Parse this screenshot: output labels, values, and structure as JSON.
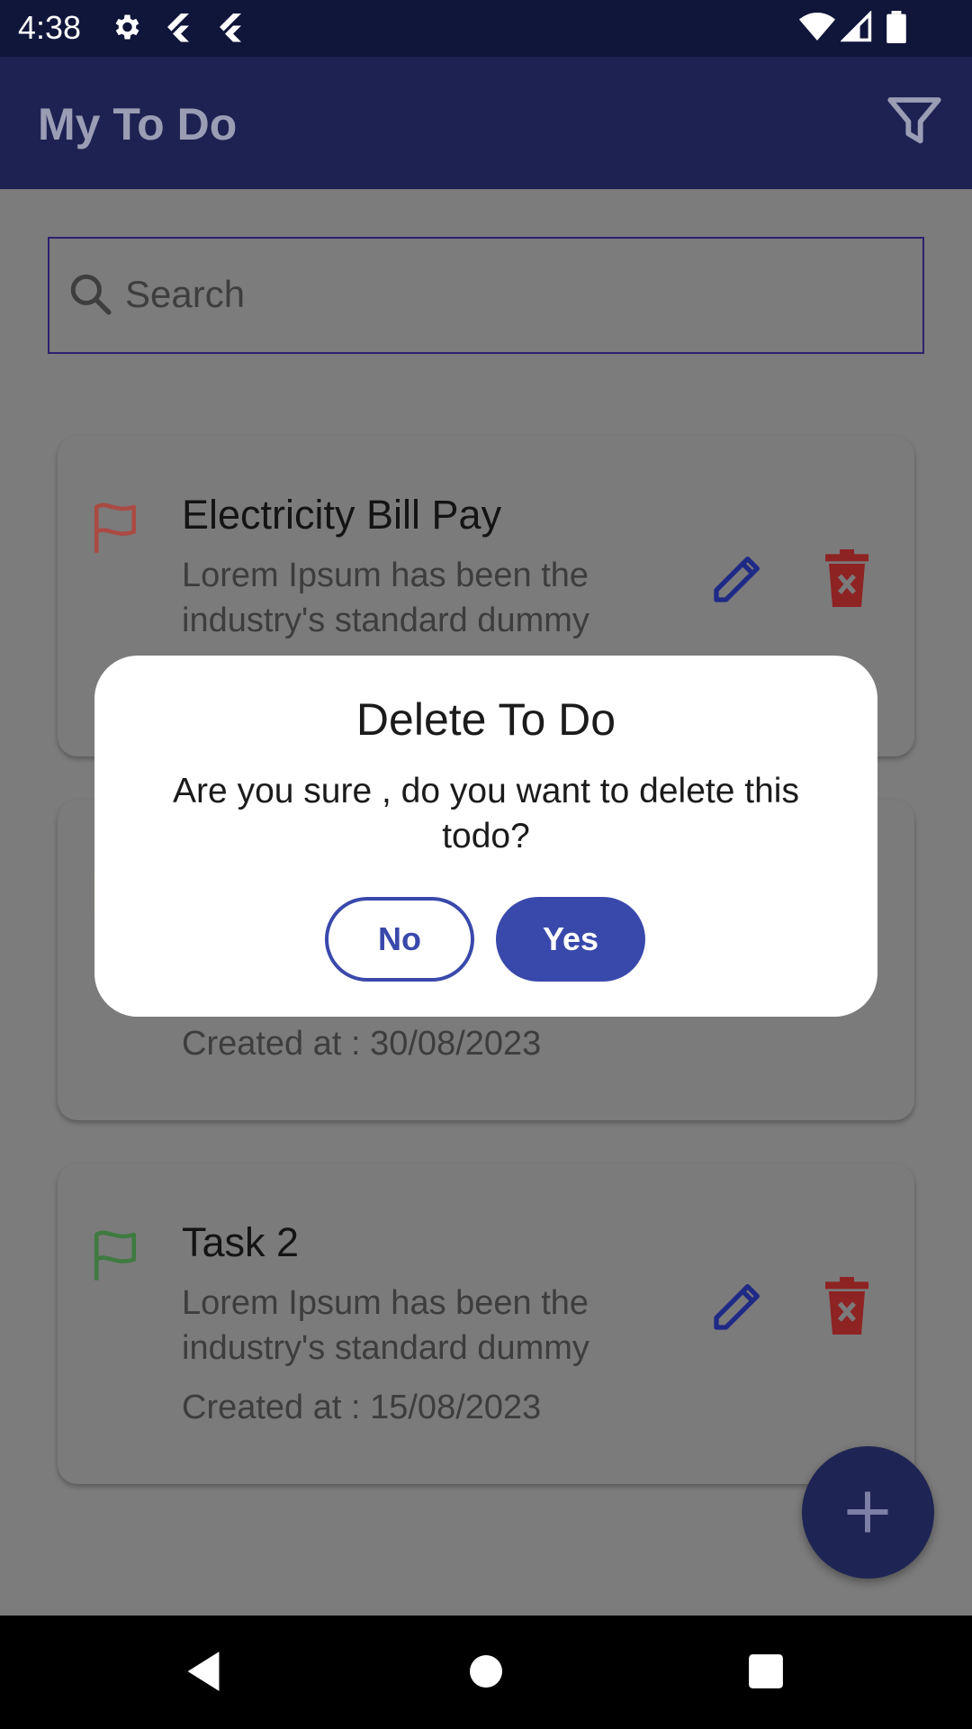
{
  "status_bar": {
    "time": "4:38",
    "icons": [
      "gear-icon",
      "flutter-icon",
      "flutter-icon",
      "wifi-icon",
      "signal-icon",
      "battery-icon"
    ]
  },
  "app_bar": {
    "title": "My To Do",
    "filter_icon": "filter-icon"
  },
  "search": {
    "placeholder": "Search",
    "value": ""
  },
  "todos": [
    {
      "title": "Electricity Bill Pay",
      "description": "Lorem Ipsum has been the industry's standard dummy",
      "created": "",
      "flag_color": "#a94b43"
    },
    {
      "title": "",
      "description": "",
      "created": "Created at : 30/08/2023",
      "flag_color": "#a08a2d"
    },
    {
      "title": "Task 2",
      "description": "Lorem Ipsum has been the industry's standard dummy",
      "created": "Created at : 15/08/2023",
      "flag_color": "#3f7a40"
    }
  ],
  "fab_icon": "plus-icon",
  "dialog": {
    "title": "Delete To Do",
    "message": "Are you sure , do you want to delete this todo?",
    "no_label": "No",
    "yes_label": "Yes"
  },
  "colors": {
    "primary": "#3949ab",
    "app_bar": "#1e2252",
    "delete": "#8e2323",
    "edit": "#1f2a86"
  },
  "nav_bar": {
    "back_icon": "back-icon",
    "home_icon": "home-icon",
    "recents_icon": "recents-icon"
  }
}
